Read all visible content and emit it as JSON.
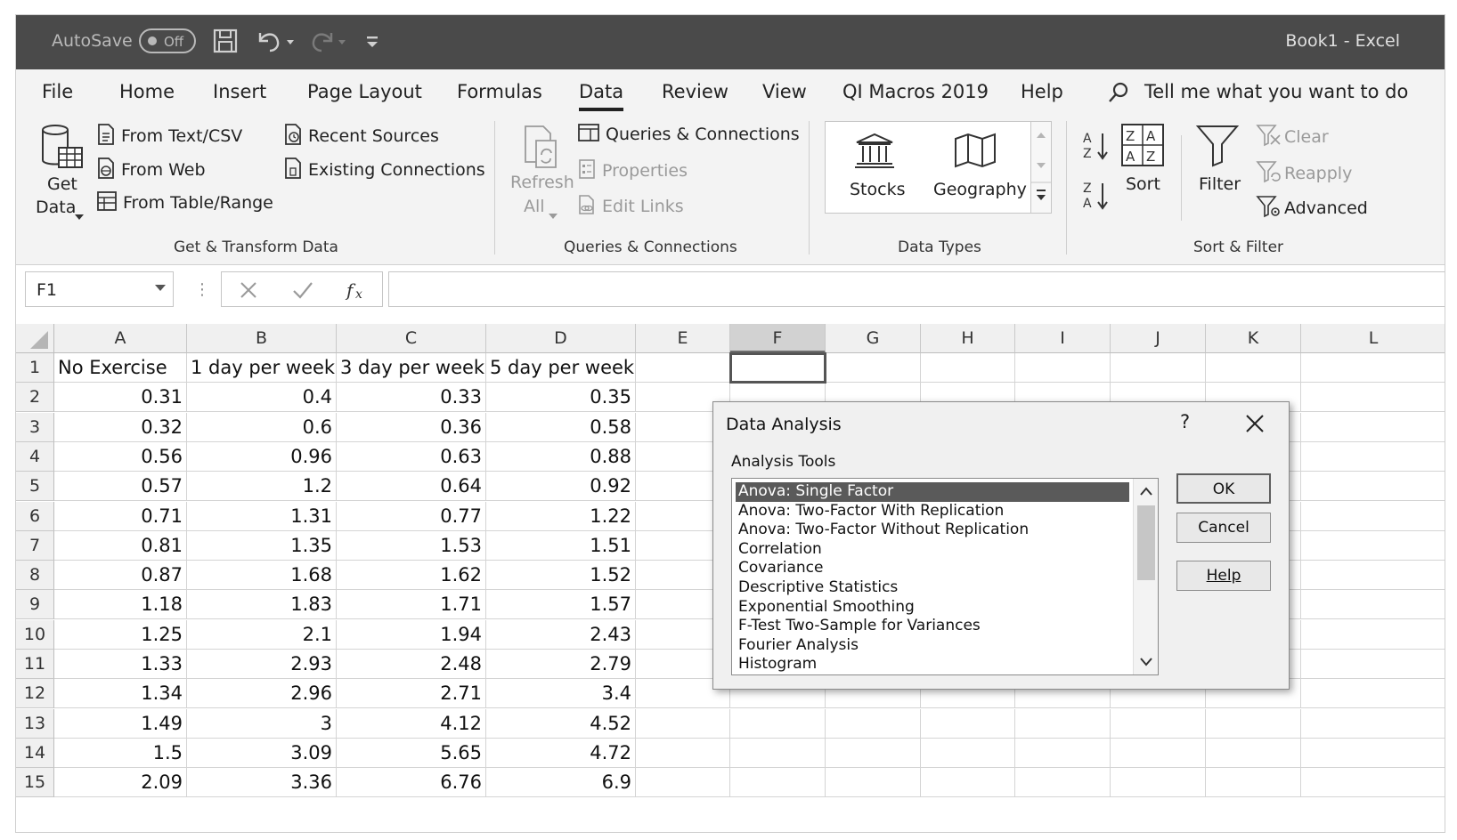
{
  "titlebar": {
    "autosave_label": "AutoSave",
    "autosave_state": "Off",
    "document_title": "Book1  -  Excel"
  },
  "tabs": [
    {
      "label": "File",
      "active": false
    },
    {
      "label": "Home",
      "active": false
    },
    {
      "label": "Insert",
      "active": false
    },
    {
      "label": "Page Layout",
      "active": false
    },
    {
      "label": "Formulas",
      "active": false
    },
    {
      "label": "Data",
      "active": true
    },
    {
      "label": "Review",
      "active": false
    },
    {
      "label": "View",
      "active": false
    },
    {
      "label": "QI Macros 2019",
      "active": false
    },
    {
      "label": "Help",
      "active": false
    }
  ],
  "tell_me": "Tell me what you want to do",
  "ribbon": {
    "get_transform": {
      "get_data_line1": "Get",
      "get_data_line2": "Data",
      "from_text_csv": "From Text/CSV",
      "from_web": "From Web",
      "from_table_range": "From Table/Range",
      "recent_sources": "Recent Sources",
      "existing_connections": "Existing Connections",
      "group_label": "Get & Transform Data"
    },
    "queries": {
      "refresh_line1": "Refresh",
      "refresh_line2": "All",
      "queries_connections": "Queries & Connections",
      "properties": "Properties",
      "edit_links": "Edit Links",
      "group_label": "Queries & Connections"
    },
    "data_types": {
      "stocks": "Stocks",
      "geography": "Geography",
      "group_label": "Data Types"
    },
    "sort_filter": {
      "sort": "Sort",
      "filter": "Filter",
      "clear": "Clear",
      "reapply": "Reapply",
      "advanced": "Advanced",
      "group_label": "Sort & Filter"
    }
  },
  "formula_bar": {
    "name_box": "F1",
    "formula": ""
  },
  "sheet": {
    "columns": [
      "A",
      "B",
      "C",
      "D",
      "E",
      "F",
      "G",
      "H",
      "I",
      "J",
      "K",
      "L"
    ],
    "selected_column": "F",
    "rows": [
      [
        "No Exercise",
        "1 day per week",
        "3 day per week",
        "5 day per week"
      ],
      [
        "0.31",
        "0.4",
        "0.33",
        "0.35"
      ],
      [
        "0.32",
        "0.6",
        "0.36",
        "0.58"
      ],
      [
        "0.56",
        "0.96",
        "0.63",
        "0.88"
      ],
      [
        "0.57",
        "1.2",
        "0.64",
        "0.92"
      ],
      [
        "0.71",
        "1.31",
        "0.77",
        "1.22"
      ],
      [
        "0.81",
        "1.35",
        "1.53",
        "1.51"
      ],
      [
        "0.87",
        "1.68",
        "1.62",
        "1.52"
      ],
      [
        "1.18",
        "1.83",
        "1.71",
        "1.57"
      ],
      [
        "1.25",
        "2.1",
        "1.94",
        "2.43"
      ],
      [
        "1.33",
        "2.93",
        "2.48",
        "2.79"
      ],
      [
        "1.34",
        "2.96",
        "2.71",
        "3.4"
      ],
      [
        "1.49",
        "3",
        "4.12",
        "4.52"
      ],
      [
        "1.5",
        "3.09",
        "5.65",
        "4.72"
      ],
      [
        "2.09",
        "3.36",
        "6.76",
        "6.9"
      ]
    ]
  },
  "dialog": {
    "title": "Data Analysis",
    "help_glyph": "?",
    "list_label": "Analysis Tools",
    "tools": [
      "Anova: Single Factor",
      "Anova: Two-Factor With Replication",
      "Anova: Two-Factor Without Replication",
      "Correlation",
      "Covariance",
      "Descriptive Statistics",
      "Exponential Smoothing",
      "F-Test Two-Sample for Variances",
      "Fourier Analysis",
      "Histogram"
    ],
    "selected_tool": "Anova: Single Factor",
    "ok": "OK",
    "cancel": "Cancel",
    "help": "Help"
  }
}
